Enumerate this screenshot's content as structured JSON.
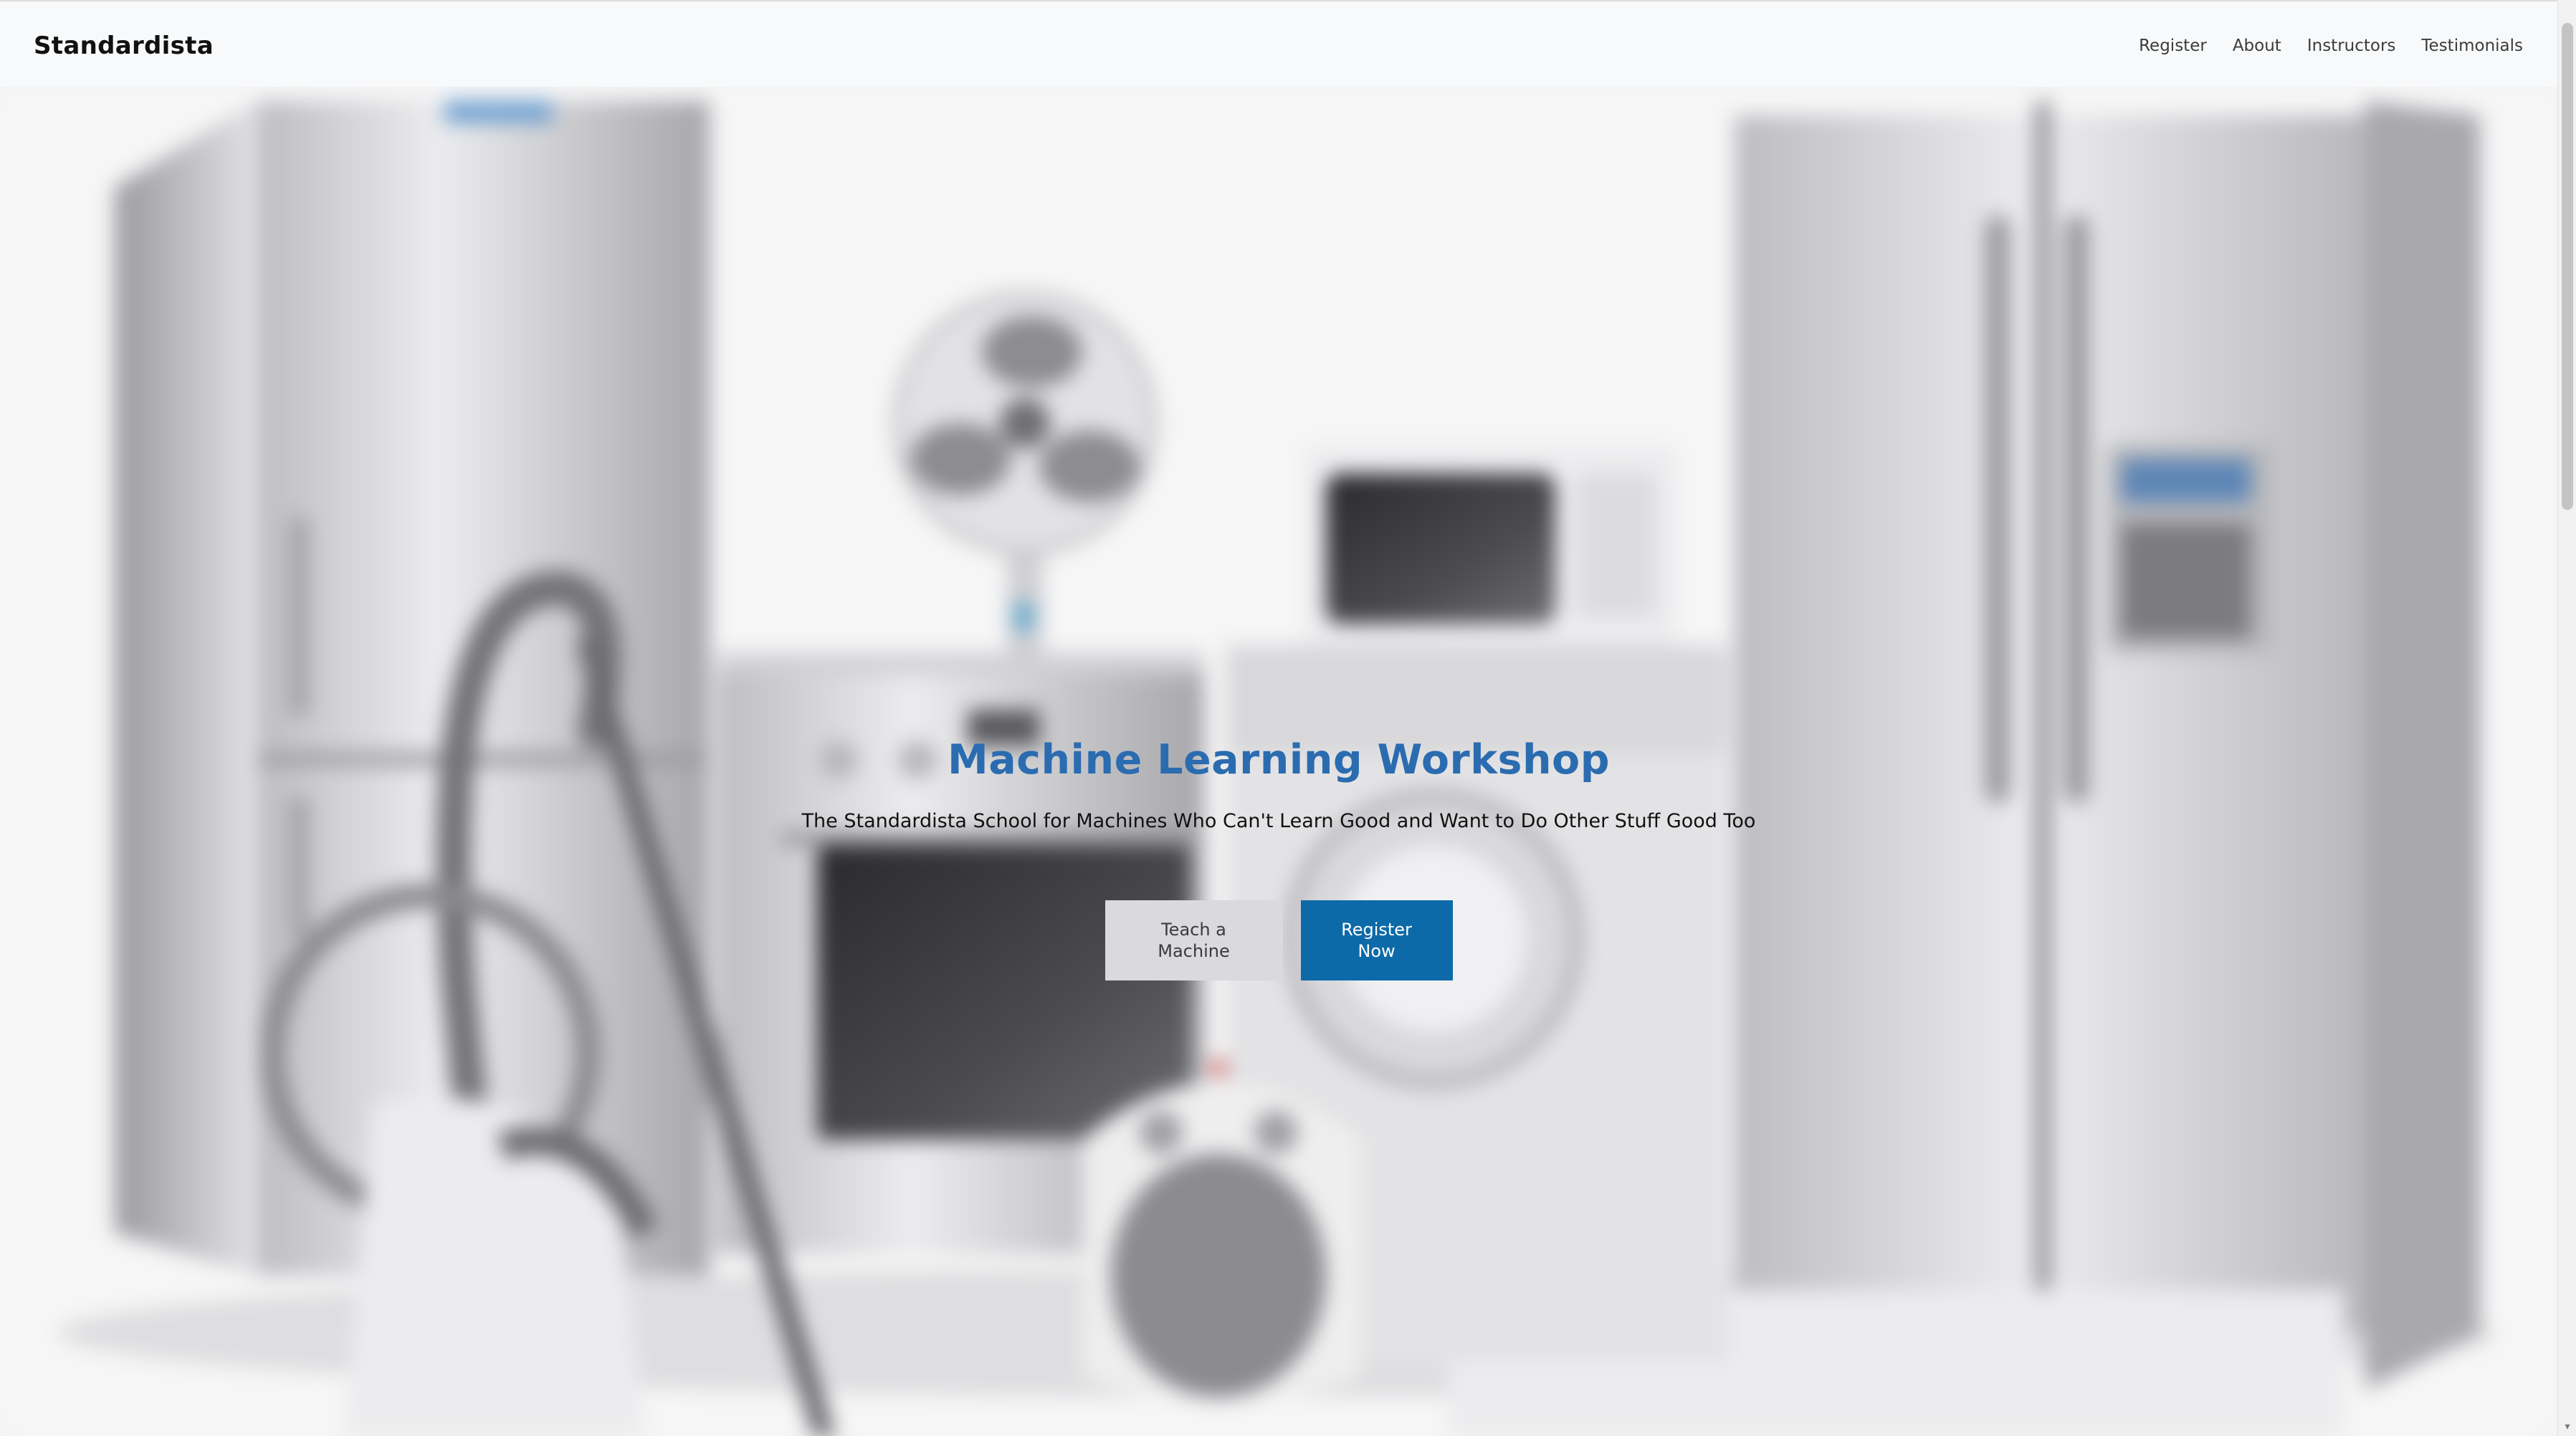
{
  "navbar": {
    "brand": "Standardista",
    "links": [
      "Register",
      "About",
      "Instructors",
      "Testimonials"
    ]
  },
  "hero": {
    "title": "Machine Learning Workshop",
    "subtitle": "The Standardista School for Machines Who Can't Learn Good and Want to Do Other Stuff Good Too",
    "secondary_button": "Teach a Machine",
    "primary_button": "Register Now"
  },
  "colors": {
    "title": "#2b6cb0",
    "primary_button": "#0d6aa8",
    "secondary_button": "#d9d9de",
    "navbar_bg": "#f8f9fa"
  },
  "icons": {
    "scroll_down": "chevron-down-icon"
  }
}
